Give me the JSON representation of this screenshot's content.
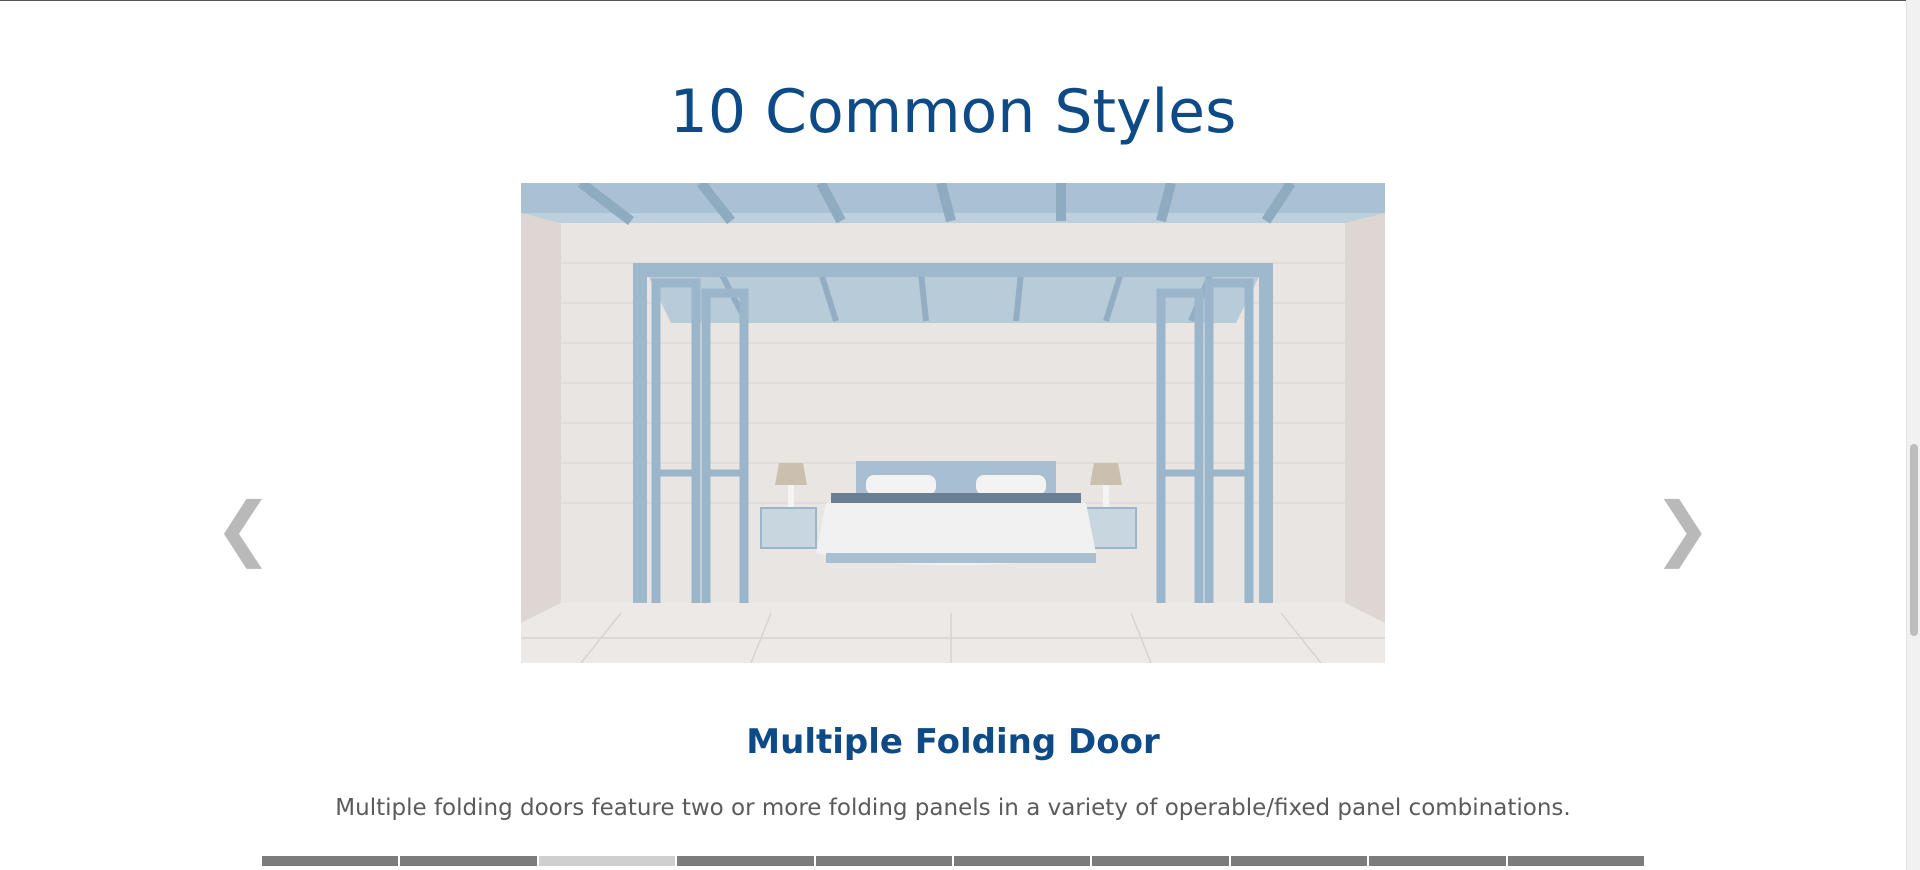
{
  "section": {
    "title": "10 Common Styles"
  },
  "carousel": {
    "prev_arrow": "❮",
    "next_arrow": "❯",
    "active_index": 2,
    "slide_count": 10,
    "slide": {
      "title": "Multiple Folding Door",
      "description": "Multiple folding doors feature two or more folding panels in a variety of operable/fixed panel combinations."
    }
  },
  "colors": {
    "heading": "#0d4a86",
    "body_text": "#5b5b5b",
    "arrow": "#b9b9b9",
    "pager_inactive": "#7c7c7c",
    "pager_active": "#cfcfcf"
  }
}
